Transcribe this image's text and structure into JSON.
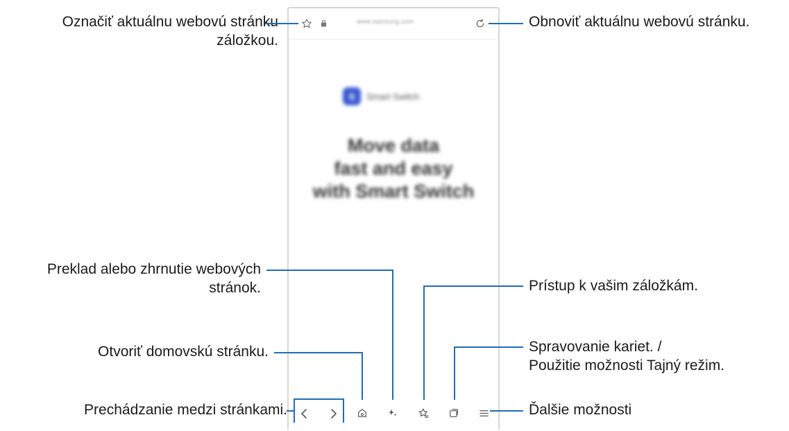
{
  "browser": {
    "url": "www.samsung.com",
    "brand_logo": "S",
    "brand_name": "Smart Switch",
    "headline_lines": [
      "Move data",
      "fast and easy",
      "with Smart Switch"
    ]
  },
  "callouts": {
    "bookmark_page": [
      "Označiť aktuálnu webovú stránku",
      "záložkou."
    ],
    "refresh": "Obnoviť aktuálnu webovú stránku.",
    "translate_summarize": [
      "Preklad alebo zhrnutie webových",
      "stránok."
    ],
    "bookmarks_access": "Prístup k vašim záložkám.",
    "home": "Otvoriť domovskú stránku.",
    "tabs": [
      "Spravovanie kariet. /",
      "Použitie možnosti Tajný režim."
    ],
    "navigate": "Prechádzanie medzi stránkami.",
    "more_options": "Ďalšie možnosti"
  },
  "colors": {
    "callout": "#1f6cb5",
    "brand": "#3a5bd0"
  }
}
